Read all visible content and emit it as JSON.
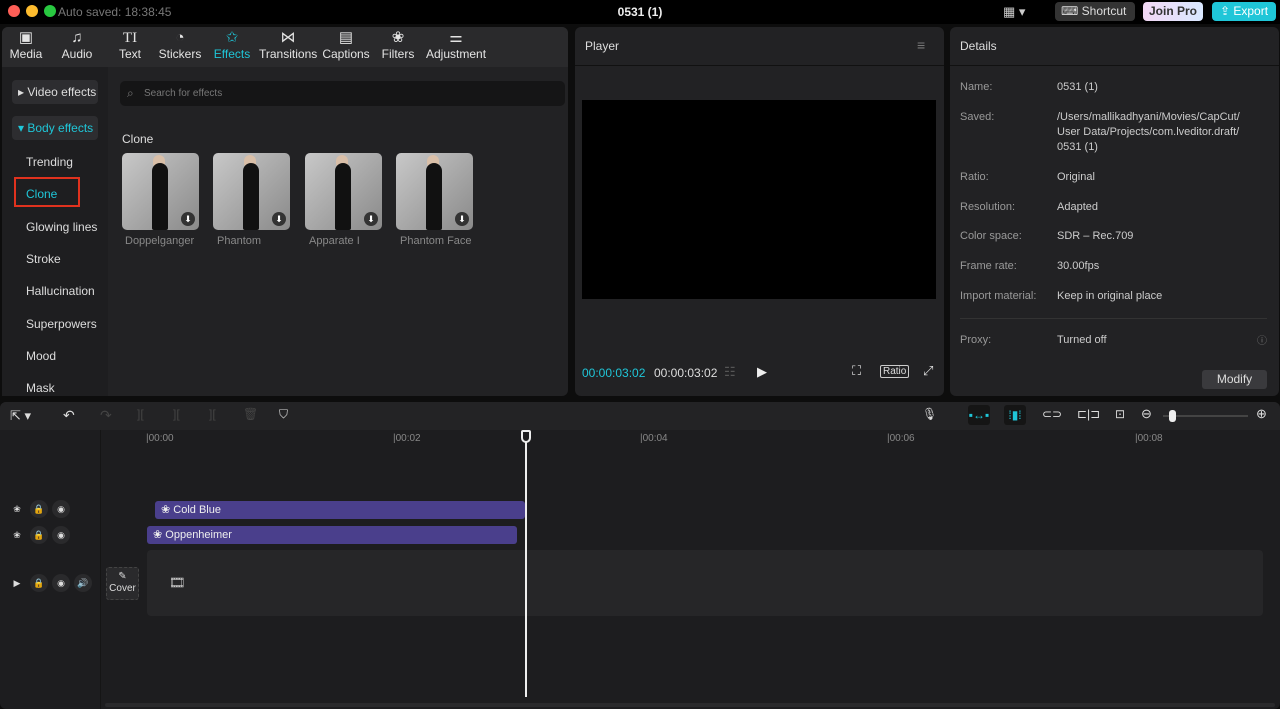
{
  "window": {
    "autosave": "Auto saved: 18:38:45",
    "title": "0531 (1)",
    "shortcut": "Shortcut",
    "join_pro": "Join Pro",
    "export": "Export"
  },
  "tabs": [
    {
      "label": "Media",
      "icon": "▣"
    },
    {
      "label": "Audio",
      "icon": "♫"
    },
    {
      "label": "Text",
      "icon": "TI"
    },
    {
      "label": "Stickers",
      "icon": "◔"
    },
    {
      "label": "Effects",
      "icon": "✩"
    },
    {
      "label": "Transitions",
      "icon": "⋈"
    },
    {
      "label": "Captions",
      "icon": "▤"
    },
    {
      "label": "Filters",
      "icon": "❀"
    },
    {
      "label": "Adjustment",
      "icon": "⚌"
    }
  ],
  "sidebar": {
    "video_effects": "▸ Video effects",
    "body_effects": "▾ Body effects",
    "items": [
      "Trending",
      "Clone",
      "Glowing lines",
      "Stroke",
      "Hallucination",
      "Superpowers",
      "Mood",
      "Mask"
    ]
  },
  "search": {
    "placeholder": "Search for effects"
  },
  "section": "Clone",
  "effects": [
    "Doppelganger",
    "Phantom",
    "Apparate I",
    "Phantom Face"
  ],
  "player": {
    "title": "Player",
    "current": "00:00:03:02",
    "total": "00:00:03:02",
    "ratio": "Ratio"
  },
  "details": {
    "title": "Details",
    "rows": [
      {
        "k": "Name:",
        "v": "0531 (1)"
      },
      {
        "k": "Saved:",
        "v": "/Users/mallikadhyani/Movies/CapCut/ User Data/Projects/com.lveditor.draft/ 0531 (1)"
      },
      {
        "k": "Ratio:",
        "v": "Original"
      },
      {
        "k": "Resolution:",
        "v": "Adapted"
      },
      {
        "k": "Color space:",
        "v": "SDR – Rec.709"
      },
      {
        "k": "Frame rate:",
        "v": "30.00fps"
      },
      {
        "k": "Import material:",
        "v": "Keep in original place"
      }
    ],
    "proxy_label": "Proxy:",
    "proxy_value": "Turned off",
    "modify": "Modify"
  },
  "timeline": {
    "ticks": [
      "|00:00",
      "|00:02",
      "|00:04",
      "|00:06",
      "|00:08"
    ],
    "clips": [
      "Cold Blue",
      "Oppenheimer"
    ],
    "cover": "Cover"
  },
  "colors": {
    "accent": "#1fc6d8",
    "clip": "#4a3f8c",
    "highlight": "#e0321e"
  }
}
